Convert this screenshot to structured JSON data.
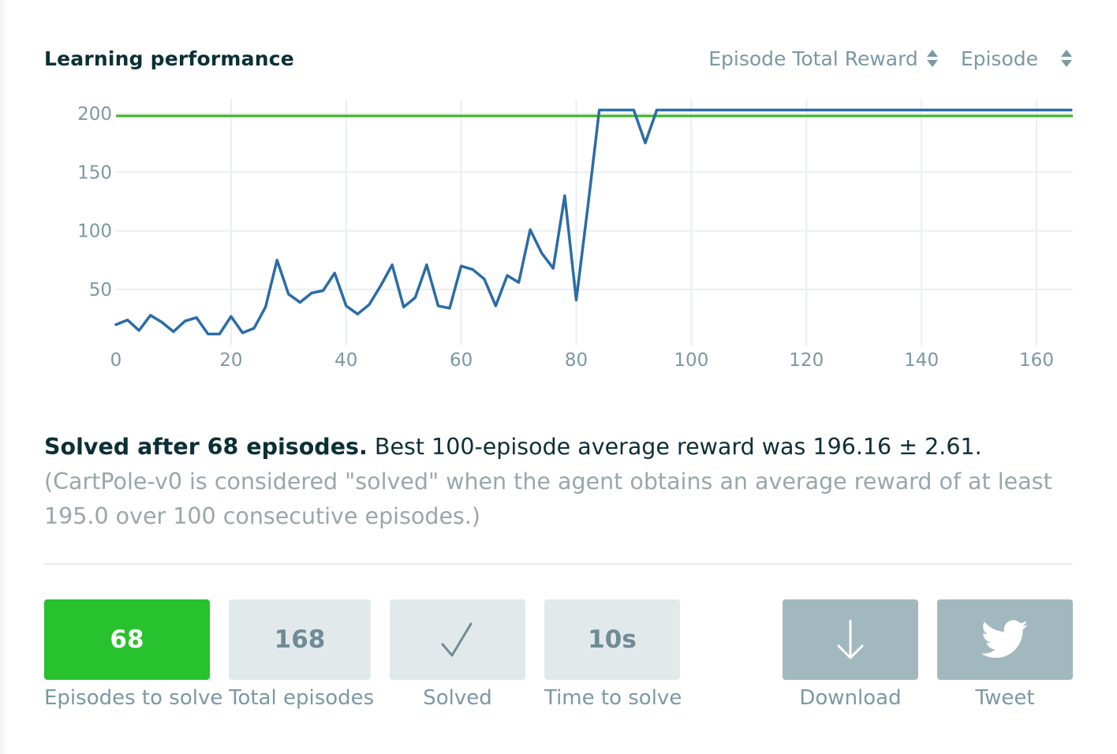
{
  "header": {
    "title": "Learning performance",
    "metric_select": "Episode Total Reward",
    "axis_select": "Episode"
  },
  "chart_data": {
    "type": "line",
    "x_ticks": [
      0,
      20,
      40,
      60,
      80,
      100,
      120,
      140,
      160
    ],
    "y_ticks": [
      50,
      100,
      150,
      200
    ],
    "xlim": [
      0,
      166
    ],
    "ylim": [
      0,
      210
    ],
    "grid": true,
    "series": [
      {
        "color": "#2b6ca7",
        "x": [
          0,
          2,
          4,
          6,
          8,
          10,
          12,
          14,
          16,
          18,
          20,
          22,
          24,
          26,
          28,
          30,
          32,
          34,
          36,
          38,
          40,
          42,
          44,
          46,
          48,
          50,
          52,
          54,
          56,
          58,
          60,
          62,
          64,
          66,
          68,
          70,
          72,
          74,
          76,
          78,
          80,
          82,
          84,
          86,
          88,
          90,
          92,
          94,
          96,
          98,
          100,
          102,
          104,
          106,
          108,
          110,
          112,
          114,
          116,
          118,
          120,
          122,
          124,
          126,
          128,
          130,
          132,
          134,
          136,
          138,
          140,
          142,
          144,
          146,
          148,
          150,
          152,
          154,
          156,
          158,
          160,
          162,
          164,
          166
        ],
        "y": [
          20,
          24,
          15,
          28,
          22,
          14,
          23,
          26,
          12,
          12,
          27,
          13,
          17,
          35,
          75,
          46,
          39,
          47,
          49,
          64,
          36,
          29,
          37,
          53,
          71,
          35,
          43,
          71,
          36,
          34,
          70,
          67,
          59,
          36,
          62,
          56,
          101,
          81,
          68,
          130,
          41,
          120,
          203,
          203,
          203,
          203,
          175,
          203,
          203,
          203,
          203,
          203,
          203,
          203,
          203,
          203,
          203,
          203,
          203,
          203,
          203,
          203,
          203,
          203,
          203,
          203,
          203,
          203,
          203,
          203,
          203,
          203,
          203,
          203,
          203,
          203,
          203,
          203,
          203,
          203,
          203,
          203,
          203,
          203
        ]
      }
    ],
    "threshold": {
      "y": 198,
      "color": "#34b61f"
    }
  },
  "summary": {
    "strong": "Solved after 68 episodes.",
    "normal": "Best 100-episode average reward was 196.16 ± 2.61.",
    "muted": "(CartPole-v0 is considered \"solved\" when the agent obtains an average reward of at least 195.0 over 100 consecutive episodes.)"
  },
  "stats": {
    "episodes_to_solve": {
      "value": "68",
      "label": "Episodes to solve"
    },
    "total_episodes": {
      "value": "168",
      "label": "Total episodes"
    },
    "solved": {
      "label": "Solved"
    },
    "time_to_solve": {
      "value": "10s",
      "label": "Time to solve"
    },
    "download": {
      "label": "Download"
    },
    "tweet": {
      "label": "Tweet"
    }
  },
  "colors": {
    "accent_green": "#27c22d",
    "tile_light": "#e2e9eb",
    "tile_dark": "#a2b8bf",
    "text_dark": "#0c2f36",
    "text_muted": "#7b98a3"
  },
  "icons": {
    "solved": "checkmark-icon",
    "download": "download-arrow-icon",
    "tweet": "twitter-bird-icon"
  }
}
